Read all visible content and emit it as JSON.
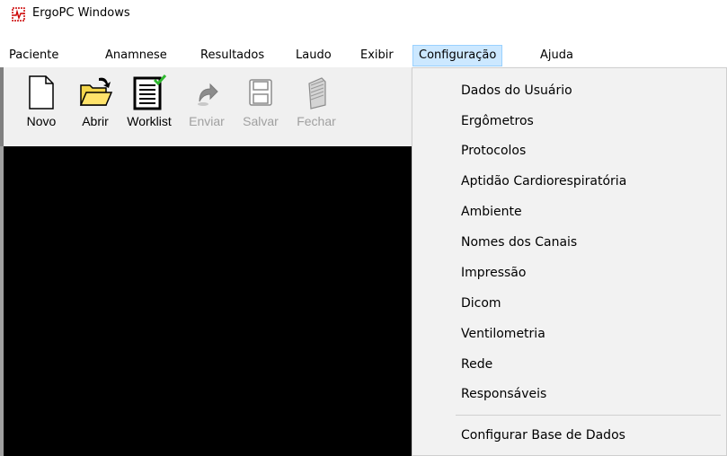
{
  "window": {
    "title": "ErgoPC Windows",
    "icon": "app-ecg-icon"
  },
  "menubar": {
    "items": [
      {
        "label": "Paciente"
      },
      {
        "label": "Anamnese"
      },
      {
        "label": "Resultados"
      },
      {
        "label": "Laudo"
      },
      {
        "label": "Exibir"
      },
      {
        "label": "Configuração",
        "active": true
      },
      {
        "label": "Ajuda"
      }
    ]
  },
  "toolbar": {
    "buttons": [
      {
        "label": "Novo",
        "icon": "new-document-icon",
        "enabled": true
      },
      {
        "label": "Abrir",
        "icon": "open-folder-icon",
        "enabled": true
      },
      {
        "label": "Worklist",
        "icon": "worklist-icon",
        "enabled": true
      },
      {
        "label": "Enviar",
        "icon": "send-arrow-icon",
        "enabled": false
      },
      {
        "label": "Salvar",
        "icon": "save-disk-icon",
        "enabled": false
      },
      {
        "label": "Fechar",
        "icon": "close-file-icon",
        "enabled": false
      }
    ]
  },
  "config_menu": {
    "items": [
      {
        "label": "Dados do Usuário"
      },
      {
        "label": "Ergômetros"
      },
      {
        "label": "Protocolos"
      },
      {
        "label": "Aptidão Cardiorespiratória"
      },
      {
        "label": "Ambiente"
      },
      {
        "label": "Nomes dos Canais"
      },
      {
        "label": "Impressão"
      },
      {
        "label": "Dicom"
      },
      {
        "label": "Ventilometria"
      },
      {
        "label": "Rede"
      },
      {
        "label": "Responsáveis"
      }
    ],
    "footer_item": {
      "label": "Configurar Base de Dados"
    }
  },
  "colors": {
    "menu_highlight": "#cce8ff",
    "workarea": "#000000",
    "worklist_check": "#2eb82e"
  }
}
